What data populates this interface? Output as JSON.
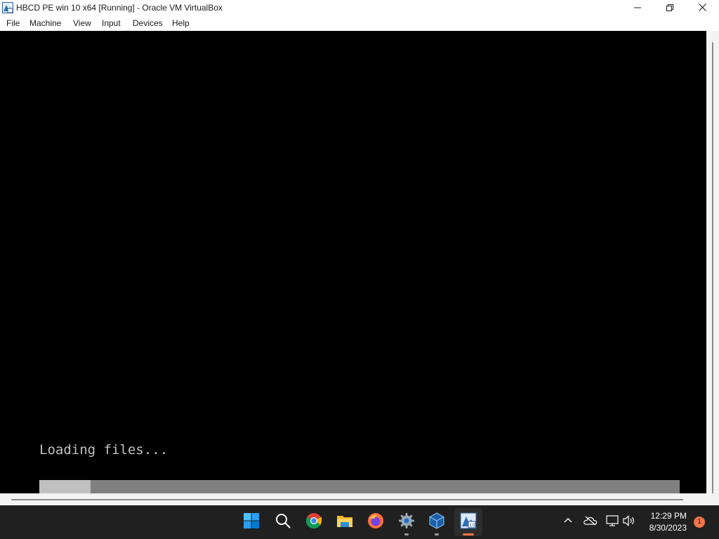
{
  "window": {
    "title": "HBCD PE win 10 x64 [Running] - Oracle VM VirtualBox",
    "icon": "virtualbox-vm-icon",
    "controls": [
      "minimize-icon",
      "restore-icon",
      "close-icon"
    ]
  },
  "menu": {
    "items": [
      "File",
      "Machine",
      "View",
      "Input",
      "Devices",
      "Help"
    ]
  },
  "vm_screen": {
    "loading_text": "Loading files...",
    "progress_fraction": 0.08
  },
  "taskbar": {
    "apps": [
      {
        "name": "windows-start-icon",
        "running": false,
        "active": false
      },
      {
        "name": "search-icon",
        "running": false,
        "active": false
      },
      {
        "name": "chrome-icon",
        "running": false,
        "active": false
      },
      {
        "name": "file-explorer-icon",
        "running": false,
        "active": false
      },
      {
        "name": "firefox-icon",
        "running": false,
        "active": false
      },
      {
        "name": "settings-gear-icon",
        "running": true,
        "active": false
      },
      {
        "name": "virtualbox-manager-icon",
        "running": true,
        "active": false
      },
      {
        "name": "virtualbox-vm-icon",
        "running": true,
        "active": true
      }
    ],
    "tray": [
      "chevron-up-icon",
      "onedrive-offline-icon",
      "network-icon",
      "volume-icon"
    ],
    "clock": {
      "time": "12:29 PM",
      "date": "8/30/2023"
    },
    "notification_count": "1"
  },
  "colors": {
    "accent_running": "#f2744b",
    "vm_background": "#000000",
    "progress_fill": "#c0c0c0",
    "progress_track": "#808080",
    "taskbar": "#202020"
  }
}
